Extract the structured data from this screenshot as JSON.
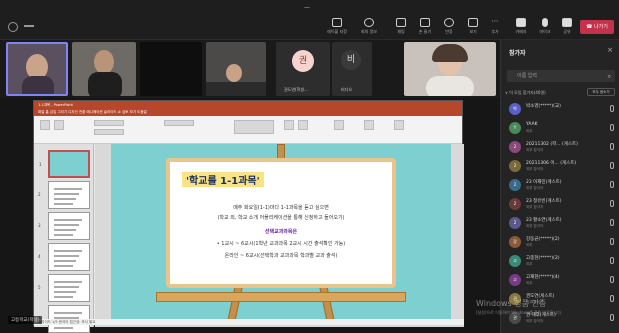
{
  "window": {
    "clock": "—"
  },
  "toolbar": {
    "buttons": [
      {
        "label": "레이블 지정",
        "icon": "label-icon"
      },
      {
        "label": "회의 정보",
        "icon": "info-icon"
      },
      {
        "label": "채팅",
        "icon": "chat-icon"
      },
      {
        "label": "손 들기",
        "icon": "hand-icon"
      },
      {
        "label": "반응",
        "icon": "reaction-icon"
      },
      {
        "label": "보기",
        "icon": "view-icon"
      },
      {
        "label": "추가",
        "icon": "more-icon"
      },
      {
        "label": "카메라",
        "icon": "camera-icon"
      },
      {
        "label": "마이크",
        "icon": "mic-icon"
      },
      {
        "label": "공유",
        "icon": "share-icon"
      }
    ],
    "leave_label": "나가기"
  },
  "video_strip": {
    "tiles": [
      {
        "name": ""
      },
      {
        "name": ""
      },
      {
        "name": ""
      },
      {
        "name": ""
      }
    ],
    "avatars": [
      {
        "initial": "권",
        "name": "권도연(학생...",
        "bg": "#f6d3cf",
        "fg": "#7a3b33"
      },
      {
        "initial": "비",
        "name": "비디오",
        "bg": "#3a3a3a",
        "fg": "#ddd"
      }
    ]
  },
  "panel": {
    "title": "참가자",
    "close": "×",
    "search_placeholder": "이름 입력",
    "section": "∨ 이 모임 참가자(40명)",
    "section_button": "모두 음소거",
    "participants": [
      {
        "initial": "박",
        "name": "박소영(*****)(교)",
        "role": "",
        "color": "#5b5fc7"
      },
      {
        "initial": "Y",
        "name": "YAAK",
        "role": "외부",
        "color": "#4a8a5a"
      },
      {
        "initial": "2",
        "name": "20211302 (학... (게스트)",
        "role": "외부 참석자",
        "color": "#8a4a7a"
      },
      {
        "initial": "2",
        "name": "20211306 이... (게스트)",
        "role": "외부 참석자",
        "color": "#7a6a3a"
      },
      {
        "initial": "2",
        "name": "23 이재민(게스트)",
        "role": "외부 참석자",
        "color": "#3a6a8a"
      },
      {
        "initial": "2",
        "name": "23 정유빈(게스트)",
        "role": "외부 참석자",
        "color": "#6a3a3a"
      },
      {
        "initial": "2",
        "name": "23 황소연(게스트)",
        "role": "외부 참석자",
        "color": "#5a5a8a"
      },
      {
        "initial": "강",
        "name": "강동균(*****)(2)",
        "role": "외부",
        "color": "#8a5a3a"
      },
      {
        "initial": "고",
        "name": "고종현(*****)(2)",
        "role": "외부",
        "color": "#3a8a7a"
      },
      {
        "initial": "고",
        "name": "고재현(*****)(4)",
        "role": "외부",
        "color": "#7a3a8a"
      },
      {
        "initial": "권",
        "name": "권도연(게스트)",
        "role": "외부 참석자",
        "color": "#8a7a3a"
      },
      {
        "initial": "권",
        "name": "권 재후(게스트)",
        "role": "외부 참석자",
        "color": "#4a4a4a"
      }
    ]
  },
  "ppt": {
    "title": "1-1과목 - PowerPoint",
    "menu": "파일  홈  삽입  그리기  디자인  전환  애니메이션  슬라이드 쇼  검토  보기  도움말",
    "status": "슬라이드 1/5  한국어  접근성: 조사 필요",
    "thumbnails": [
      "1",
      "2",
      "3",
      "4",
      "5",
      "6"
    ]
  },
  "slide": {
    "title": "'학교를 1-1과목'",
    "lines": [
      "매주 화요일(1-1)마다 1-1과목을 듣고 싶으면",
      "(학교 외, 학교 소개 어플리케이션을 통해 신청하고 들어오기)",
      "선택교과과목은",
      "• 1교시 ~ 6교시(1학년 교과과목 2교시 시간 출석확인 가능)",
      "온라인 ~ 6교시(선택학과 교과과목 학과별 교과 출석)"
    ]
  },
  "overlay": {
    "user_label": "고등학교(학생)",
    "watermark": "Windows 정품 인증",
    "watermark_sub": "[설정]으로 이동하여 Windows를 정품 인증합니다."
  }
}
